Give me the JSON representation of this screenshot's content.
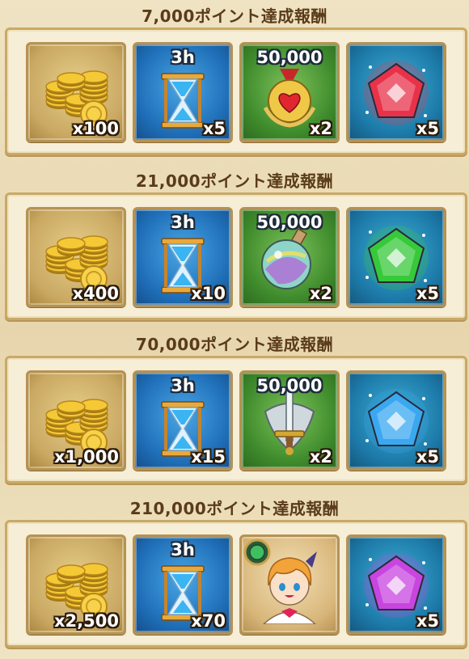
{
  "tiers": [
    {
      "title": "7,000ポイント達成報酬",
      "rewards": [
        {
          "kind": "gold-coins",
          "icon": "gold-coins-icon",
          "qty": "x100",
          "label": ""
        },
        {
          "kind": "hourglass",
          "icon": "hourglass-icon",
          "qty": "x5",
          "label": "3h"
        },
        {
          "kind": "medal",
          "icon": "heart-medal-icon",
          "qty": "x2",
          "label": "50,000"
        },
        {
          "kind": "gem",
          "icon": "red-gem-icon",
          "qty": "x5",
          "label": "",
          "gem_color": "#e8324a"
        }
      ]
    },
    {
      "title": "21,000ポイント達成報酬",
      "rewards": [
        {
          "kind": "gold-coins",
          "icon": "gold-coins-icon",
          "qty": "x400",
          "label": ""
        },
        {
          "kind": "hourglass",
          "icon": "hourglass-icon",
          "qty": "x10",
          "label": "3h"
        },
        {
          "kind": "potion",
          "icon": "rainbow-potion-icon",
          "qty": "x2",
          "label": "50,000"
        },
        {
          "kind": "gem",
          "icon": "green-gem-icon",
          "qty": "x5",
          "label": "",
          "gem_color": "#36c93a"
        }
      ]
    },
    {
      "title": "70,000ポイント達成報酬",
      "rewards": [
        {
          "kind": "gold-coins",
          "icon": "gold-coins-icon",
          "qty": "x1,000",
          "label": ""
        },
        {
          "kind": "hourglass",
          "icon": "hourglass-icon",
          "qty": "x15",
          "label": "3h"
        },
        {
          "kind": "sword",
          "icon": "sword-emblem-icon",
          "qty": "x2",
          "label": "50,000"
        },
        {
          "kind": "gem",
          "icon": "blue-gem-icon",
          "qty": "x5",
          "label": "",
          "gem_color": "#3aa8f0"
        }
      ]
    },
    {
      "title": "210,000ポイント達成報酬",
      "rewards": [
        {
          "kind": "gold-coins",
          "icon": "gold-coins-icon",
          "qty": "x2,500",
          "label": ""
        },
        {
          "kind": "hourglass",
          "icon": "hourglass-icon",
          "qty": "x70",
          "label": "3h"
        },
        {
          "kind": "character",
          "icon": "character-portrait-icon",
          "qty": "",
          "label": ""
        },
        {
          "kind": "gem",
          "icon": "purple-gem-icon",
          "qty": "x5",
          "label": "",
          "gem_color": "#c845e0"
        }
      ]
    }
  ]
}
